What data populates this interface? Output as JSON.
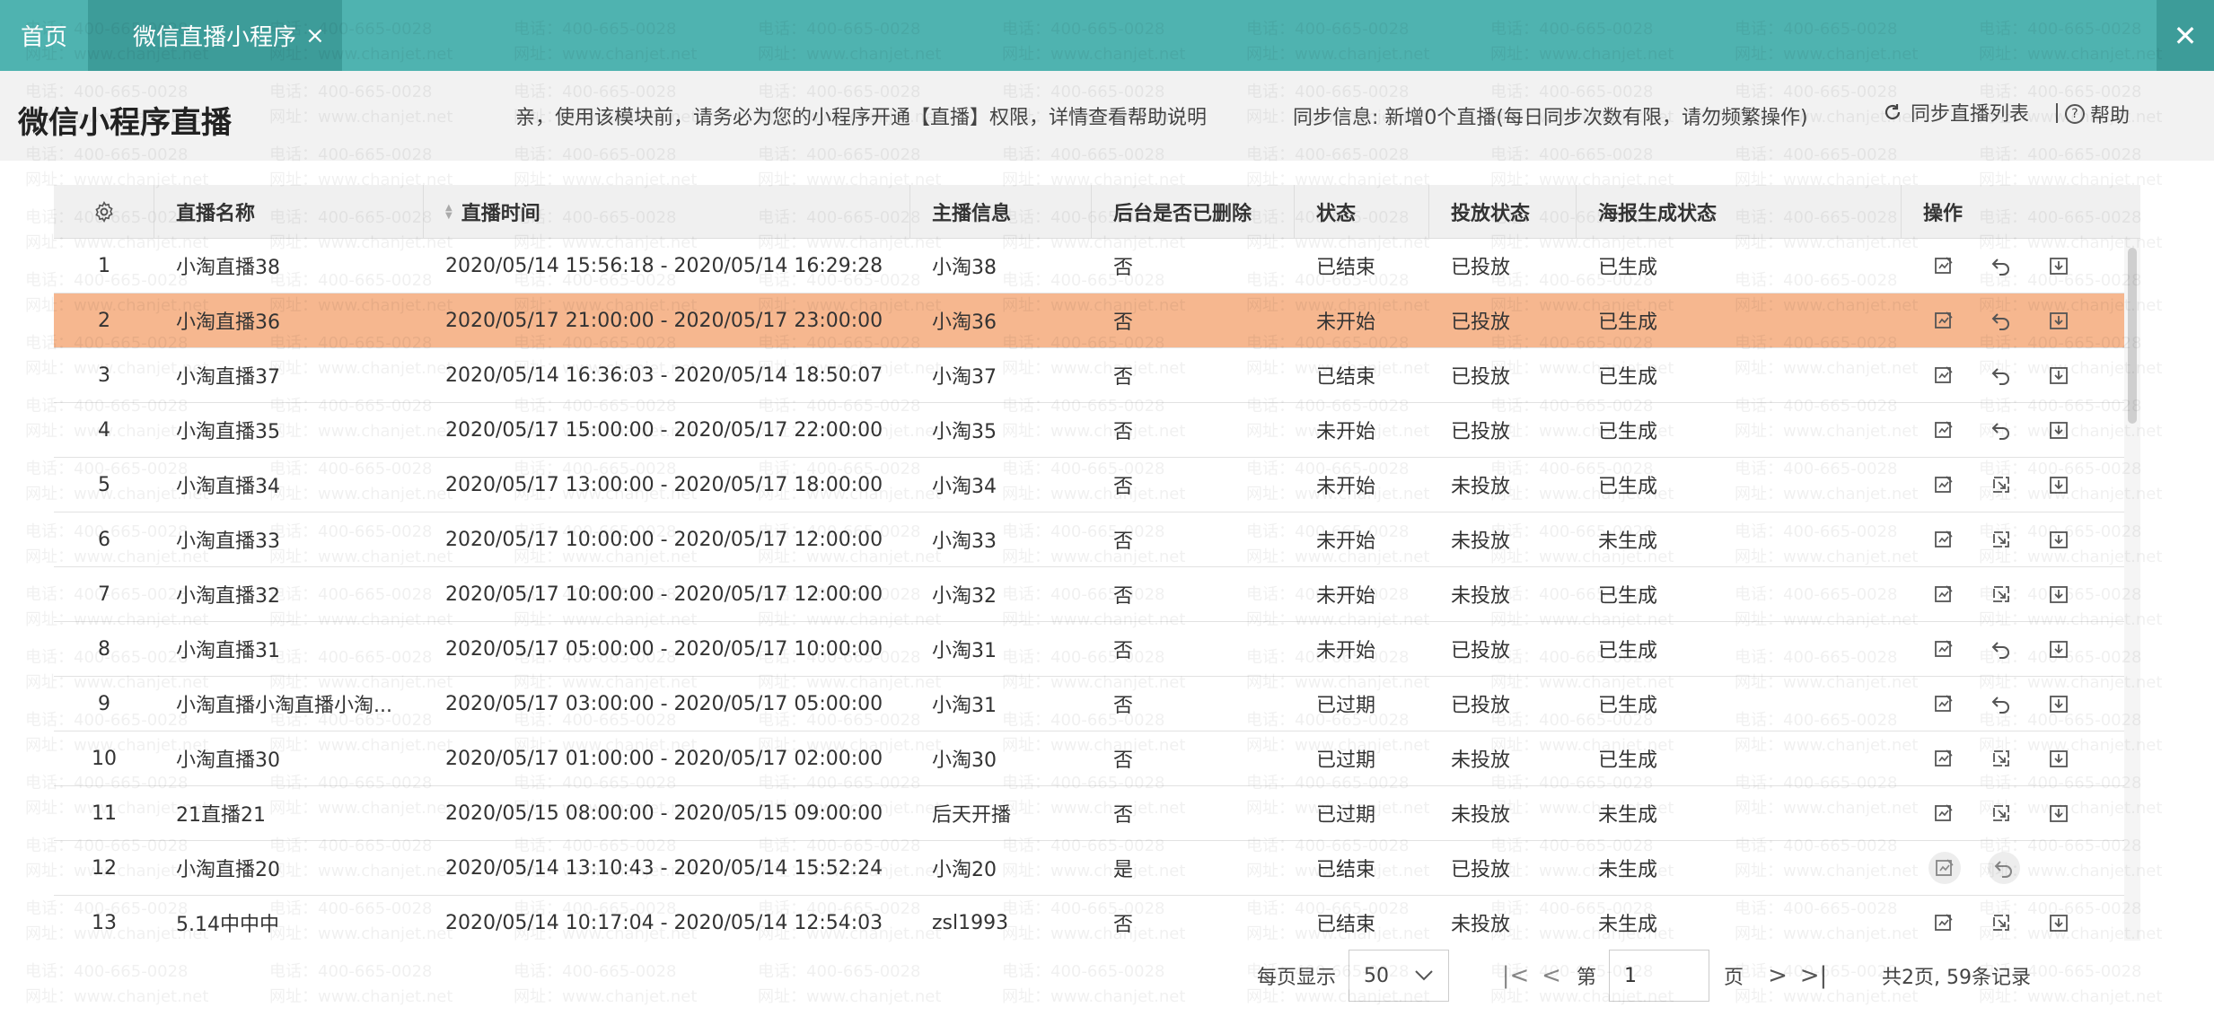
{
  "tabs": {
    "home": "首页",
    "active": "微信直播小程序"
  },
  "header": {
    "title": "微信小程序直播",
    "tip": "亲，使用该模块前，请务必为您的小程序开通【直播】权限，详情查看帮助说明",
    "sync_info": "同步信息: 新增0个直播(每日同步次数有限，请勿频繁操作)",
    "sync_label": "同步直播列表",
    "help_label": "帮助"
  },
  "columns": [
    "直播名称",
    "直播时间",
    "主播信息",
    "后台是否已删除",
    "状态",
    "投放状态",
    "海报生成状态",
    "操作"
  ],
  "rows": [
    {
      "no": "1",
      "name": "小淘直播38",
      "time": "2020/05/14 15:56:18 - 2020/05/14 16:29:28",
      "anchor": "小淘38",
      "deleted": "否",
      "status": "已结束",
      "release": "已投放",
      "poster": "已生成",
      "op2": "undo"
    },
    {
      "no": "2",
      "name": "小淘直播36",
      "time": "2020/05/17 21:00:00 - 2020/05/17 23:00:00",
      "anchor": "小淘36",
      "deleted": "否",
      "status": "未开始",
      "release": "已投放",
      "poster": "已生成",
      "op2": "undo"
    },
    {
      "no": "3",
      "name": "小淘直播37",
      "time": "2020/05/14 16:36:03 - 2020/05/14 18:50:07",
      "anchor": "小淘37",
      "deleted": "否",
      "status": "已结束",
      "release": "已投放",
      "poster": "已生成",
      "op2": "undo"
    },
    {
      "no": "4",
      "name": "小淘直播35",
      "time": "2020/05/17 15:00:00 - 2020/05/17 22:00:00",
      "anchor": "小淘35",
      "deleted": "否",
      "status": "未开始",
      "release": "已投放",
      "poster": "已生成",
      "op2": "undo"
    },
    {
      "no": "5",
      "name": "小淘直播34",
      "time": "2020/05/17 13:00:00 - 2020/05/17 18:00:00",
      "anchor": "小淘34",
      "deleted": "否",
      "status": "未开始",
      "release": "未投放",
      "poster": "已生成",
      "op2": "release"
    },
    {
      "no": "6",
      "name": "小淘直播33",
      "time": "2020/05/17 10:00:00 - 2020/05/17 12:00:00",
      "anchor": "小淘33",
      "deleted": "否",
      "status": "未开始",
      "release": "未投放",
      "poster": "未生成",
      "op2": "release"
    },
    {
      "no": "7",
      "name": "小淘直播32",
      "time": "2020/05/17 10:00:00 - 2020/05/17 12:00:00",
      "anchor": "小淘32",
      "deleted": "否",
      "status": "未开始",
      "release": "未投放",
      "poster": "已生成",
      "op2": "release"
    },
    {
      "no": "8",
      "name": "小淘直播31",
      "time": "2020/05/17 05:00:00 - 2020/05/17 10:00:00",
      "anchor": "小淘31",
      "deleted": "否",
      "status": "未开始",
      "release": "已投放",
      "poster": "已生成",
      "op2": "undo"
    },
    {
      "no": "9",
      "name": "小淘直播小淘直播小淘...",
      "time": "2020/05/17 03:00:00 - 2020/05/17 05:00:00",
      "anchor": "小淘31",
      "deleted": "否",
      "status": "已过期",
      "release": "已投放",
      "poster": "已生成",
      "op2": "undo"
    },
    {
      "no": "10",
      "name": "小淘直播30",
      "time": "2020/05/17 01:00:00 - 2020/05/17 02:00:00",
      "anchor": "小淘30",
      "deleted": "否",
      "status": "已过期",
      "release": "未投放",
      "poster": "已生成",
      "op2": "release"
    },
    {
      "no": "11",
      "name": "21直播21",
      "time": "2020/05/15 08:00:00 - 2020/05/15 09:00:00",
      "anchor": "后天开播",
      "deleted": "否",
      "status": "已过期",
      "release": "未投放",
      "poster": "未生成",
      "op2": "release"
    },
    {
      "no": "12",
      "name": "小淘直播20",
      "time": "2020/05/14 13:10:43 - 2020/05/14 15:52:24",
      "anchor": "小淘20",
      "deleted": "是",
      "status": "已结束",
      "release": "已投放",
      "poster": "未生成",
      "op2": "undo"
    },
    {
      "no": "13",
      "name": "5.14中中中",
      "time": "2020/05/14 10:17:04 - 2020/05/14 12:54:03",
      "anchor": "zsl1993",
      "deleted": "否",
      "status": "已结束",
      "release": "未投放",
      "poster": "未生成",
      "op2": "release"
    }
  ],
  "selected_row": 2,
  "pagination": {
    "per_page_label": "每页显示",
    "per_page": "50",
    "page_prefix": "第",
    "page_value": "1",
    "page_suffix": "页",
    "total": "共2页, 59条记录"
  },
  "watermark": {
    "phone": "电话：400-665-0028",
    "site": "网址：www.chanjet.net"
  },
  "colors": {
    "topbar": "#4fb3b0",
    "tab_active": "#3d9c99",
    "selected_row": "#f6b78f"
  }
}
